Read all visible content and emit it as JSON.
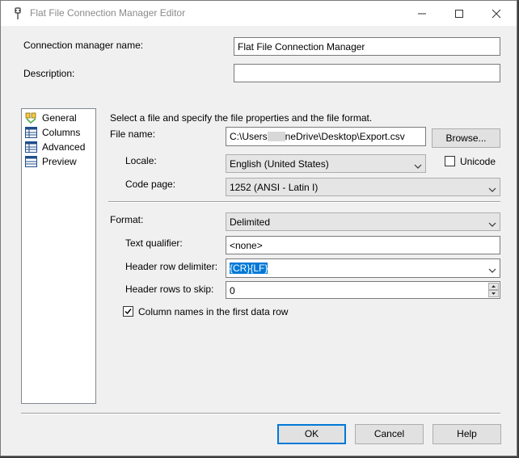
{
  "window": {
    "title": "Flat File Connection Manager Editor"
  },
  "header": {
    "connection_name_label": "Connection manager name:",
    "connection_name_value": "Flat File Connection Manager",
    "description_label": "Description:",
    "description_value": ""
  },
  "nav": {
    "items": [
      {
        "label": "General",
        "icon": "general-icon"
      },
      {
        "label": "Columns",
        "icon": "grid-icon"
      },
      {
        "label": "Advanced",
        "icon": "grid-icon"
      },
      {
        "label": "Preview",
        "icon": "grid-icon"
      }
    ],
    "selected": "General"
  },
  "general": {
    "intro": "Select a file and specify the file properties and the file format.",
    "file_name_label": "File name:",
    "file_name_prefix": "C:\\Users",
    "file_name_suffix": "neDrive\\Desktop\\Export.csv",
    "browse_label": "Browse...",
    "locale_label": "Locale:",
    "locale_value": "English (United States)",
    "unicode_label": "Unicode",
    "unicode_checked": false,
    "code_page_label": "Code page:",
    "code_page_value": "1252  (ANSI - Latin I)",
    "format_label": "Format:",
    "format_value": "Delimited",
    "text_qualifier_label": "Text qualifier:",
    "text_qualifier_value": "<none>",
    "header_row_delimiter_label": "Header row delimiter:",
    "header_row_delimiter_value": "{CR}{LF}",
    "header_rows_to_skip_label": "Header rows to skip:",
    "header_rows_to_skip_value": "0",
    "column_names_label": "Column names in the first data row",
    "column_names_checked": true
  },
  "footer": {
    "ok_label": "OK",
    "cancel_label": "Cancel",
    "help_label": "Help"
  },
  "colors": {
    "accent": "#0078d7",
    "dialog_bg": "#f0f0f0"
  }
}
